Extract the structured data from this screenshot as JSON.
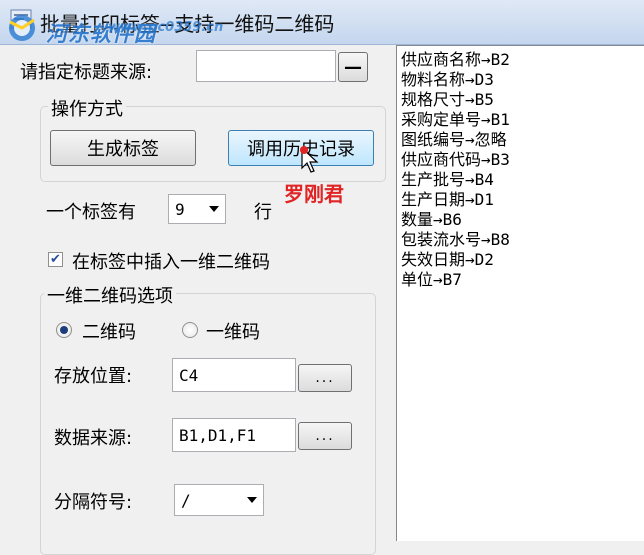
{
  "window": {
    "title": "批量打印标签--支持一维码二维码",
    "watermark": "河东软件园",
    "watermark_url": "www.pc0359.cn"
  },
  "title_source": {
    "label": "请指定标题来源:",
    "value": "",
    "button_label": "—"
  },
  "operation": {
    "legend": "操作方式",
    "generate_label": "生成标签",
    "history_label": "调用历史记录"
  },
  "signature": "罗刚君",
  "rows": {
    "prefix": "一个标签有",
    "value": "9",
    "suffix": "行"
  },
  "insert_barcode": {
    "label": "在标签中插入一维二维码",
    "checked": true
  },
  "barcode_options": {
    "legend": "一维二维码选项",
    "radio_2d_label": "二维码",
    "radio_1d_label": "一维码",
    "selected": "二维码",
    "position_label": "存放位置:",
    "position_value": "C4",
    "data_source_label": "数据来源:",
    "data_source_value": "B1,D1,F1",
    "separator_label": "分隔符号:",
    "separator_value": "/",
    "browse_label": "..."
  },
  "mapping_list": [
    "供应商名称→B2",
    "物料名称→D3",
    "规格尺寸→B5",
    "采购定单号→B1",
    "图纸编号→忽略",
    "供应商代码→B3",
    "生产批号→B4",
    "生产日期→D1",
    "数量→B6",
    "包装流水号→B8",
    "失效日期→D2",
    "单位→B7"
  ]
}
